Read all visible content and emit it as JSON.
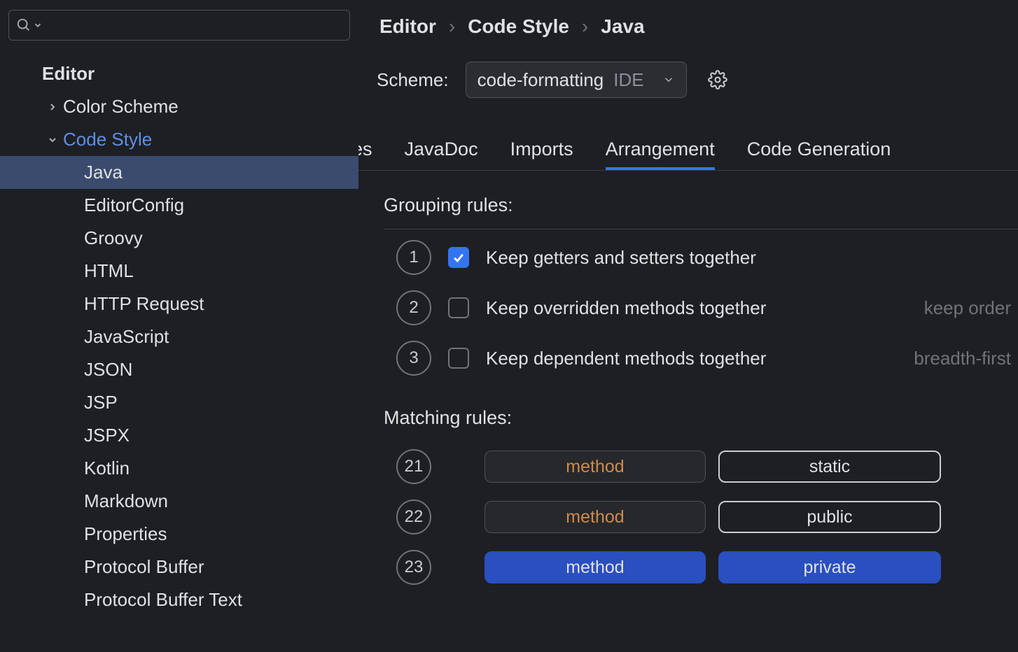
{
  "sidebar": {
    "root": "Editor",
    "colorScheme": "Color Scheme",
    "codeStyle": "Code Style",
    "items": [
      "Java",
      "EditorConfig",
      "Groovy",
      "HTML",
      "HTTP Request",
      "JavaScript",
      "JSON",
      "JSP",
      "JSPX",
      "Kotlin",
      "Markdown",
      "Properties",
      "Protocol Buffer",
      "Protocol Buffer Text"
    ]
  },
  "breadcrumb": {
    "a": "Editor",
    "b": "Code Style",
    "c": "Java"
  },
  "scheme": {
    "label": "Scheme:",
    "name": "code-formatting",
    "scope": "IDE"
  },
  "tabs": {
    "lines": "ines",
    "javadoc": "JavaDoc",
    "imports": "Imports",
    "arrangement": "Arrangement",
    "generation": "Code Generation"
  },
  "sections": {
    "grouping": "Grouping rules:",
    "matching": "Matching rules:"
  },
  "grouping": [
    {
      "n": "1",
      "label": "Keep getters and setters together",
      "hint": ""
    },
    {
      "n": "2",
      "label": "Keep overridden methods together",
      "hint": "keep order"
    },
    {
      "n": "3",
      "label": "Keep dependent methods together",
      "hint": "breadth-first"
    }
  ],
  "matching": [
    {
      "n": "21",
      "a": "method",
      "b": "static"
    },
    {
      "n": "22",
      "a": "method",
      "b": "public"
    },
    {
      "n": "23",
      "a": "method",
      "b": "private"
    }
  ]
}
